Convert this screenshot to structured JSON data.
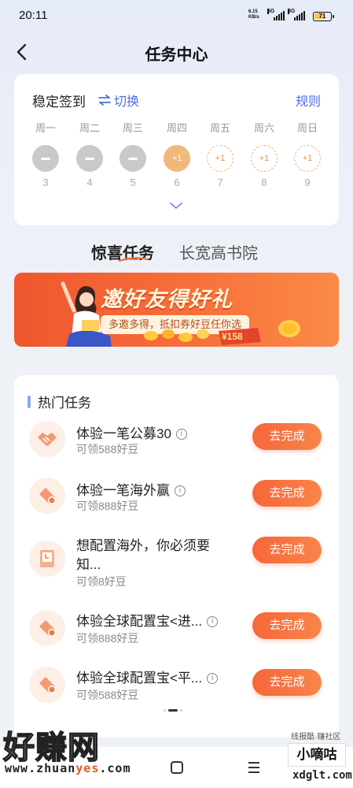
{
  "status_bar": {
    "time": "20:11",
    "net_speed": "6.15",
    "net_unit": "KB/s",
    "sim1": "5G",
    "sim2": "5G",
    "battery": "71"
  },
  "header": {
    "title": "任务中心",
    "back_icon": "chevron-left-icon"
  },
  "sign_in": {
    "title": "稳定签到",
    "switch_label": "切换",
    "rules_label": "规则",
    "days": [
      {
        "weekday": "周一",
        "date": "3",
        "state": "done",
        "reward": ""
      },
      {
        "weekday": "周二",
        "date": "4",
        "state": "done",
        "reward": ""
      },
      {
        "weekday": "周三",
        "date": "5",
        "state": "done",
        "reward": ""
      },
      {
        "weekday": "周四",
        "date": "6",
        "state": "today",
        "reward": "+1"
      },
      {
        "weekday": "周五",
        "date": "7",
        "state": "future",
        "reward": "+1"
      },
      {
        "weekday": "周六",
        "date": "8",
        "state": "future",
        "reward": "+1"
      },
      {
        "weekday": "周日",
        "date": "9",
        "state": "future",
        "reward": "+1"
      }
    ]
  },
  "tabs": [
    {
      "label": "惊喜任务",
      "active": true
    },
    {
      "label": "长宽高书院",
      "active": false
    }
  ],
  "banner": {
    "title": "邀好友得好礼",
    "subtitle": "多邀多得，抵扣券好豆任你选",
    "price": "¥158"
  },
  "hot_tasks": {
    "title": "热门任务",
    "button_label": "去完成",
    "items": [
      {
        "name": "体验一笔公募30",
        "name_line2": "",
        "reward": "可领588好豆",
        "has_info": true,
        "icon": "handshake-icon"
      },
      {
        "name": "体验一笔海外赢",
        "name_line2": "",
        "reward": "可领888好豆",
        "has_info": true,
        "icon": "money-tag-icon"
      },
      {
        "name": "想配置海外，你必须要",
        "name_line2": "知...",
        "reward": "可领8好豆",
        "has_info": false,
        "icon": "book-icon"
      },
      {
        "name": "体验全球配置宝<进...",
        "name_line2": "",
        "reward": "可领888好豆",
        "has_info": true,
        "icon": "money-tag-icon"
      },
      {
        "name": "体验全球配置宝<平...",
        "name_line2": "",
        "reward": "可领588好豆",
        "has_info": true,
        "icon": "money-tag-icon"
      }
    ]
  },
  "watermark": {
    "left_text": "好赚网",
    "left_url_a": "www.zhuan",
    "left_url_b": "yes",
    "left_url_c": ".com",
    "right_small": "线报酷·赚社区",
    "right_box": "小嘀咕",
    "right_url": "xdglt.com"
  },
  "colors": {
    "accent_blue": "#4a6ee0",
    "accent_orange": "#f7663a",
    "banner_orange": "#f0562e"
  }
}
